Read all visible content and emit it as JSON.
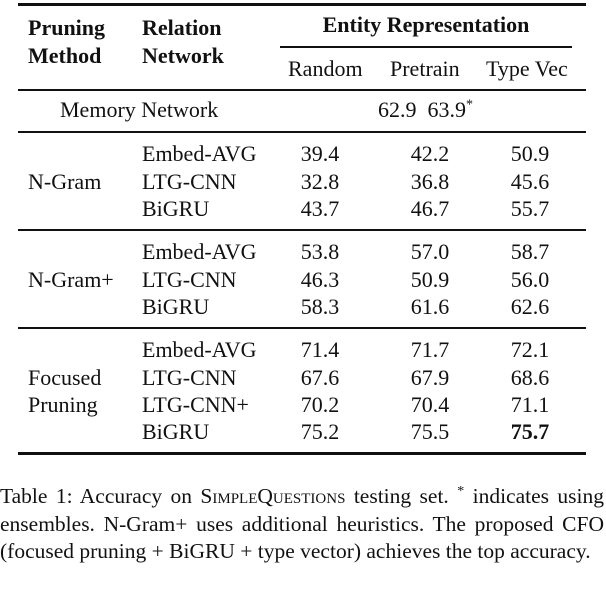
{
  "table": {
    "headers": {
      "pruning_method": [
        "Pruning",
        "Method"
      ],
      "relation_network": [
        "Relation",
        "Network"
      ],
      "entity_representation": "Entity Representation",
      "columns": [
        "Random",
        "Pretrain",
        "Type Vec"
      ]
    },
    "memory_network": {
      "label": "Memory Network",
      "value": "62.9  63.9",
      "note_marker": "*"
    },
    "groups": [
      {
        "method": [
          "N-Gram"
        ],
        "rows": [
          {
            "network": "Embed-AVG",
            "values": [
              "39.4",
              "42.2",
              "50.9"
            ]
          },
          {
            "network": "LTG-CNN",
            "values": [
              "32.8",
              "36.8",
              "45.6"
            ]
          },
          {
            "network": "BiGRU",
            "values": [
              "43.7",
              "46.7",
              "55.7"
            ]
          }
        ]
      },
      {
        "method": [
          "N-Gram+"
        ],
        "rows": [
          {
            "network": "Embed-AVG",
            "values": [
              "53.8",
              "57.0",
              "58.7"
            ]
          },
          {
            "network": "LTG-CNN",
            "values": [
              "46.3",
              "50.9",
              "56.0"
            ]
          },
          {
            "network": "BiGRU",
            "values": [
              "58.3",
              "61.6",
              "62.6"
            ]
          }
        ]
      },
      {
        "method": [
          "Focused",
          "Pruning"
        ],
        "rows": [
          {
            "network": "Embed-AVG",
            "values": [
              "71.4",
              "71.7",
              "72.1"
            ]
          },
          {
            "network": "LTG-CNN",
            "values": [
              "67.6",
              "67.9",
              "68.6"
            ]
          },
          {
            "network": "LTG-CNN+",
            "values": [
              "70.2",
              "70.4",
              "71.1"
            ]
          },
          {
            "network": "BiGRU",
            "values": [
              "75.2",
              "75.5",
              "75.7"
            ],
            "bold_last": true
          }
        ]
      }
    ]
  },
  "caption": {
    "prefix": "Table 1: Accuracy on ",
    "dataset": "SimpleQuestions",
    "after_dataset": " testing set. ",
    "marker": "*",
    "rest": " indicates using ensembles.  N-Gram+ uses additional heuristics. The proposed CFO (focused pruning + BiGRU + type vector) achieves the top accuracy."
  }
}
